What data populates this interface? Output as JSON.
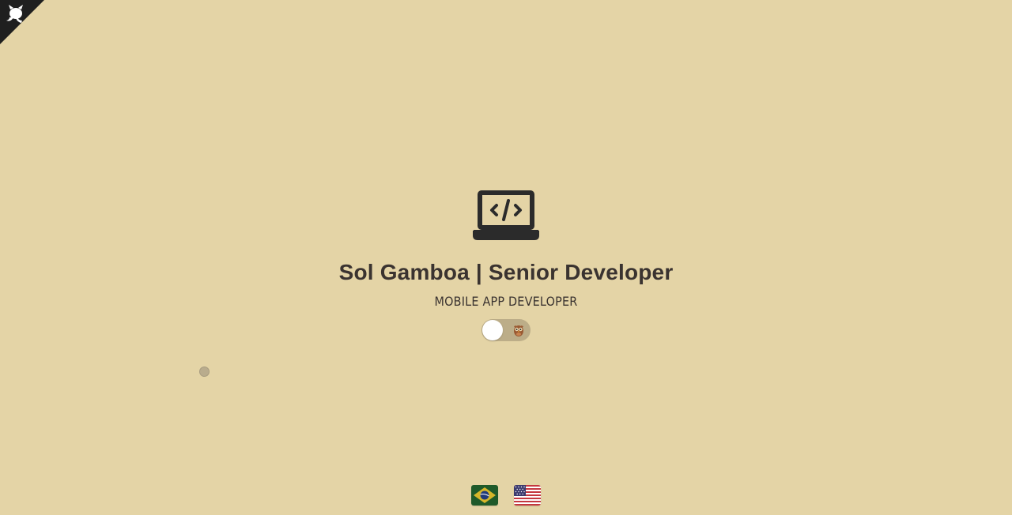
{
  "header": {
    "corner_icon": "github-octocat-icon"
  },
  "hero": {
    "icon": "laptop-code-icon",
    "title": "Sol Gamboa | Senior Developer",
    "subtitle": "MOBILE APP DEVELOPER"
  },
  "theme_toggle": {
    "state": "off",
    "icon": "owl-icon"
  },
  "cursor_indicator": {
    "icon": "cursor-dot"
  },
  "languages": [
    {
      "code": "pt-BR",
      "flag_icon": "brazil-flag-icon"
    },
    {
      "code": "en-US",
      "flag_icon": "usa-flag-icon"
    }
  ],
  "colors": {
    "background": "#e4d4a6",
    "text": "#3a3330",
    "corner": "#1f1f1f",
    "toggle_track": "#bcad88"
  }
}
